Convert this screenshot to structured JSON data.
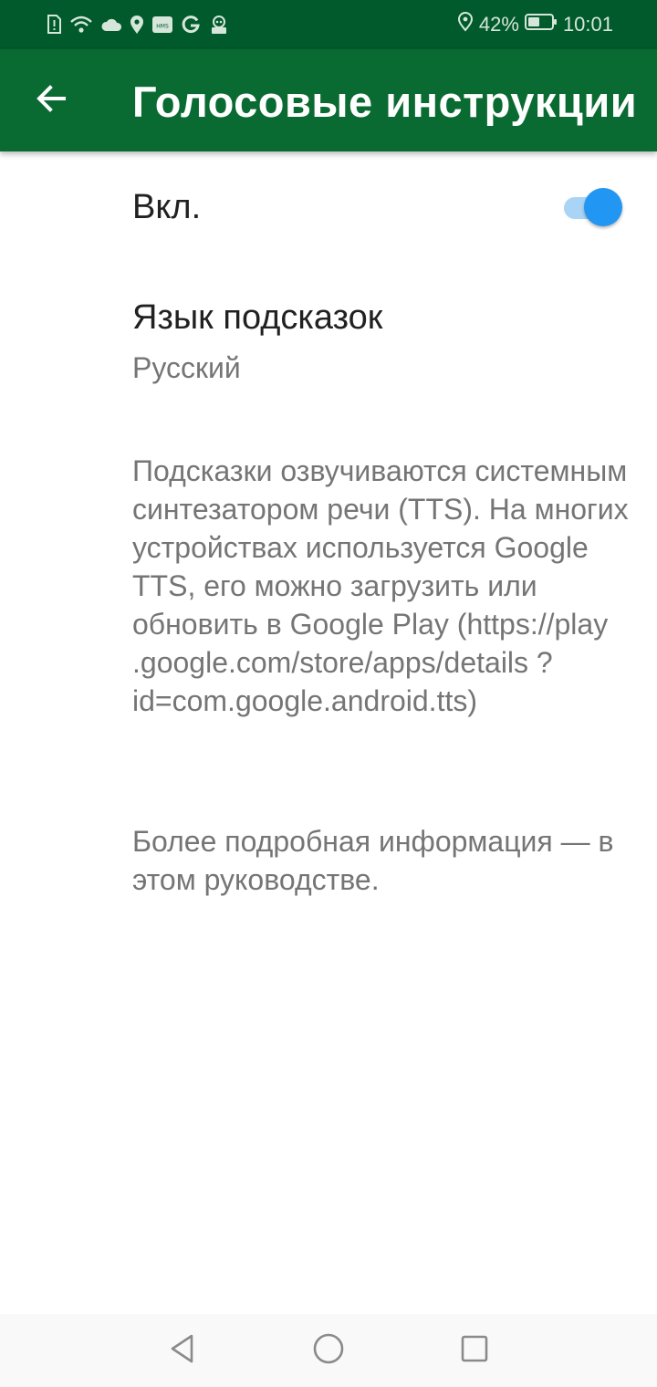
{
  "status_bar": {
    "left_icons": [
      "sim-alert-icon",
      "wifi-icon",
      "cloud-icon",
      "location-pin-icon",
      "hms-icon",
      "google-icon",
      "assistant-icon"
    ],
    "battery": "42%",
    "time": "10:01"
  },
  "app_bar": {
    "title": "Голосовые инструкции",
    "back_icon": "arrow-back-icon"
  },
  "settings": {
    "enabled_label": "Вкл.",
    "enabled": true,
    "language_title": "Язык подсказок",
    "language_value": "Русский"
  },
  "info": {
    "tts_text": "Подсказки озвучиваются системным синтезатором речи (TTS). На многих устройствах используется Google TTS, его можно загрузить или обновить в Google Play (https://play .google.com/store/apps/details ?id=com.google.android.tts)",
    "guide_text": "Более подробная информация — в этом руководстве."
  },
  "colors": {
    "status_bar": "#005a2b",
    "app_bar": "#0a6b32",
    "switch_thumb": "#2196f3",
    "switch_track": "#a9d4f5"
  },
  "nav_bar": {
    "icons": [
      "back-triangle-icon",
      "home-circle-icon",
      "recents-square-icon"
    ]
  }
}
